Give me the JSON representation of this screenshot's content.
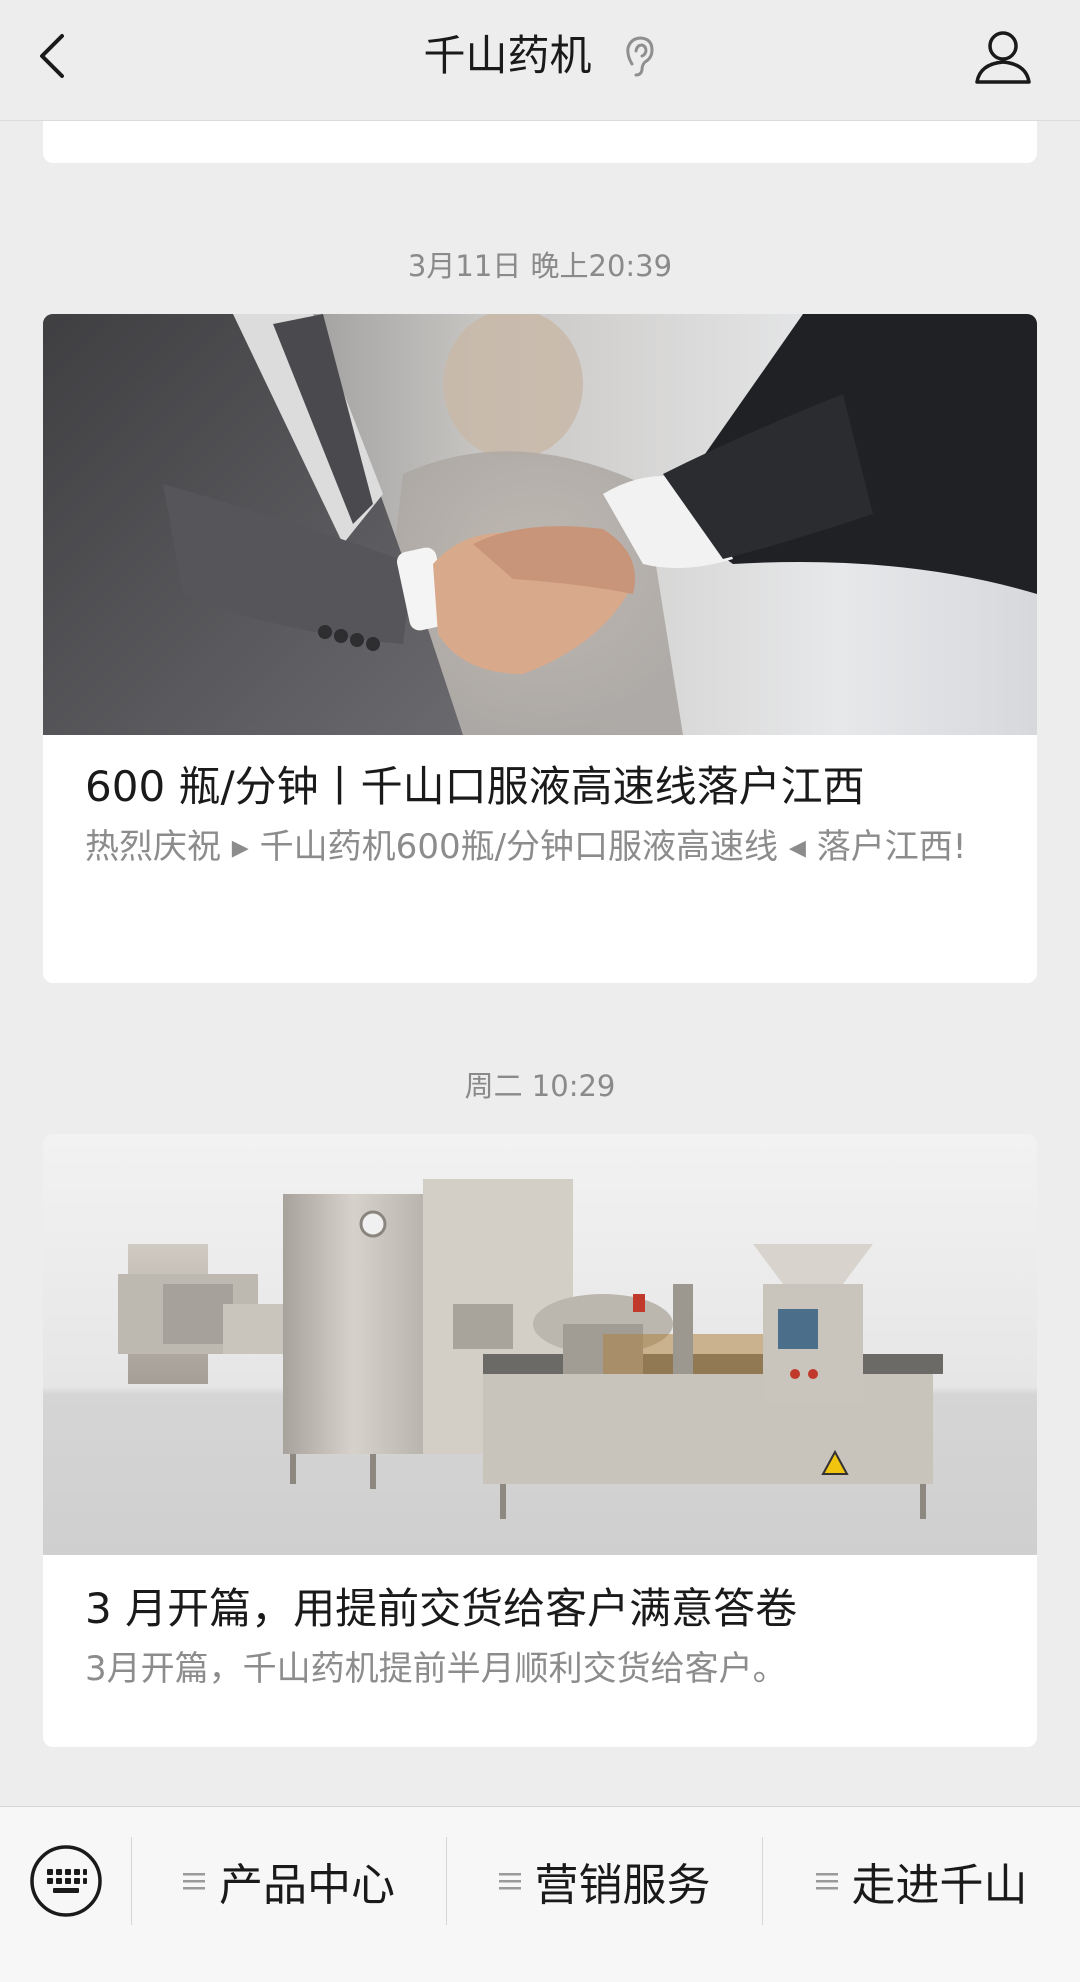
{
  "header": {
    "title": "千山药机"
  },
  "feed": {
    "messages": [
      {
        "timestamp": "3月11日 晚上20:39",
        "title": "600 瓶/分钟丨千山口服液高速线落户江西",
        "description": "热烈庆祝 ▸ 千山药机600瓶/分钟口服液高速线 ◂ 落户江西!"
      },
      {
        "timestamp": "周二 10:29",
        "title": "3 月开篇，用提前交货给客户满意答卷",
        "description": "3月开篇，千山药机提前半月顺利交货给客户。"
      }
    ]
  },
  "menu": {
    "items": [
      {
        "label": "产品中心"
      },
      {
        "label": "营销服务"
      },
      {
        "label": "走进千山"
      }
    ]
  },
  "icons": {
    "back": "chevron-left-icon",
    "ear": "ear-icon",
    "profile": "user-icon",
    "keyboard": "keyboard-icon",
    "menu": "menu-lines-icon"
  },
  "colors": {
    "background": "#ededed",
    "card": "#ffffff",
    "title_text": "#1a1a1a",
    "secondary_text": "#8c8c8c"
  }
}
